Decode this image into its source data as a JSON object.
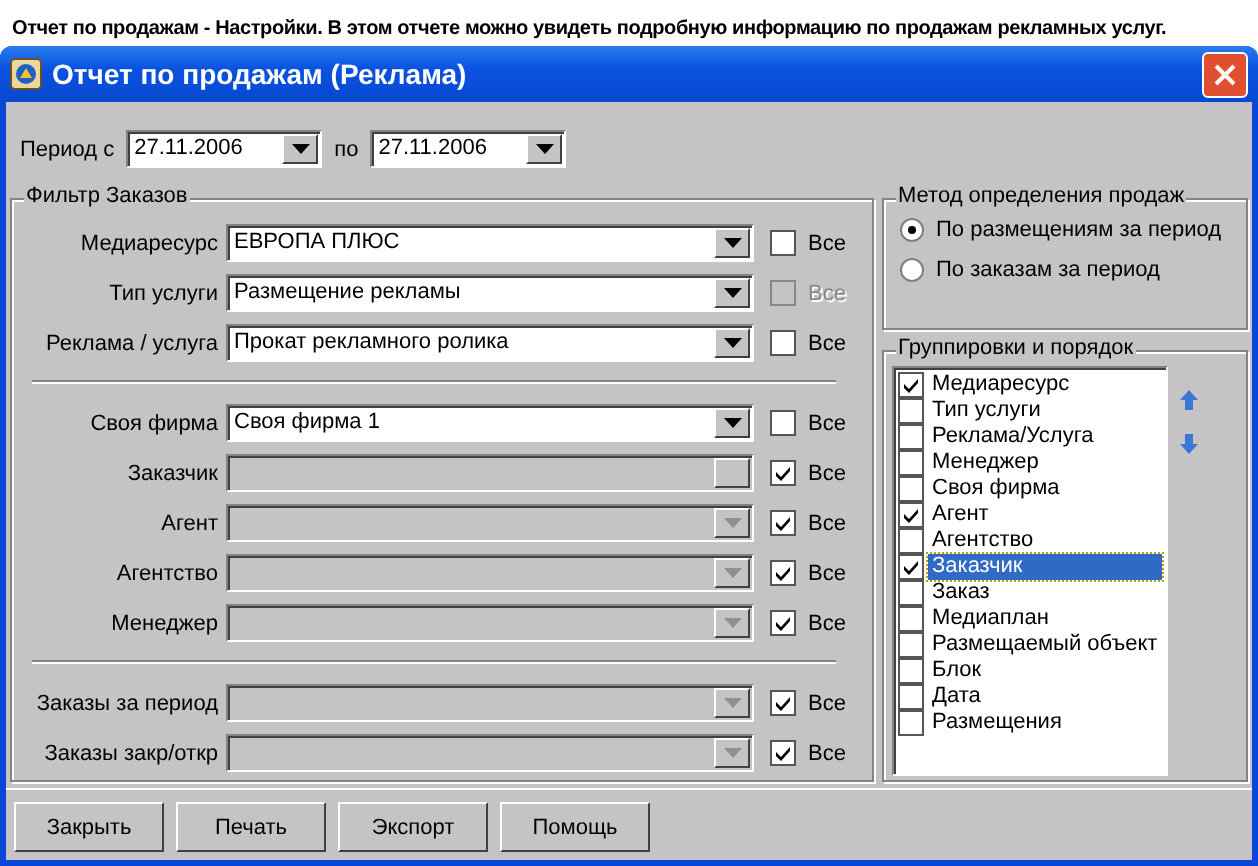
{
  "caption": "Отчет по продажам - Настройки. В этом отчете можно увидеть подробную информацию по продажам рекламных услуг.",
  "window": {
    "title": "Отчет по продажам (Реклама)"
  },
  "period": {
    "from_label": "Период с",
    "from": "27.11.2006",
    "to_label": "по",
    "to": "27.11.2006"
  },
  "filter": {
    "title": "Фильтр Заказов",
    "groups": [
      [
        {
          "label": "Медиаресурс",
          "value": "ЕВРОПА ПЛЮС",
          "disabled": false,
          "all_label": "Все",
          "all_checked": false,
          "all_disabled": false
        },
        {
          "label": "Тип услуги",
          "value": "Размещение рекламы",
          "disabled": false,
          "all_label": "Все",
          "all_checked": false,
          "all_disabled": true
        },
        {
          "label": "Реклама / услуга",
          "value": "Прокат рекламного ролика",
          "disabled": false,
          "all_label": "Все",
          "all_checked": false,
          "all_disabled": false
        }
      ],
      [
        {
          "label": "Своя фирма",
          "value": "Своя фирма 1",
          "disabled": false,
          "all_label": "Все",
          "all_checked": false,
          "all_disabled": false
        },
        {
          "label": "Заказчик",
          "disabled": true,
          "all_label": "Все",
          "all_checked": true,
          "all_disabled": false
        },
        {
          "label": "Агент",
          "disabled": true,
          "all_label": "Все",
          "all_checked": true,
          "all_disabled": false
        },
        {
          "label": "Агентство",
          "disabled": true,
          "all_label": "Все",
          "all_checked": true,
          "all_disabled": false
        },
        {
          "label": "Менеджер",
          "disabled": true,
          "all_label": "Все",
          "all_checked": true,
          "all_disabled": false
        }
      ],
      [
        {
          "label": "Заказы за период",
          "disabled": true,
          "all_label": "Все",
          "all_checked": true,
          "all_disabled": false
        },
        {
          "label": "Заказы закр/откр",
          "disabled": true,
          "all_label": "Все",
          "all_checked": true,
          "all_disabled": false
        }
      ]
    ]
  },
  "method": {
    "title": "Метод определения продаж",
    "options": [
      {
        "label": "По размещениям за период",
        "selected": true
      },
      {
        "label": "По заказам за период",
        "selected": false
      }
    ]
  },
  "grouping": {
    "title": "Группировки и порядок",
    "items": [
      {
        "label": "Медиаресурс",
        "checked": true,
        "selected": false
      },
      {
        "label": "Тип услуги",
        "checked": false,
        "selected": false
      },
      {
        "label": "Реклама/Услуга",
        "checked": false,
        "selected": false
      },
      {
        "label": "Менеджер",
        "checked": false,
        "selected": false
      },
      {
        "label": "Своя фирма",
        "checked": false,
        "selected": false
      },
      {
        "label": "Агент",
        "checked": true,
        "selected": false
      },
      {
        "label": "Агентство",
        "checked": false,
        "selected": false
      },
      {
        "label": "Заказчик",
        "checked": true,
        "selected": true
      },
      {
        "label": "Заказ",
        "checked": false,
        "selected": false
      },
      {
        "label": "Медиаплан",
        "checked": false,
        "selected": false
      },
      {
        "label": "Размещаемый объект",
        "checked": false,
        "selected": false
      },
      {
        "label": "Блок",
        "checked": false,
        "selected": false
      },
      {
        "label": "Дата",
        "checked": false,
        "selected": false
      },
      {
        "label": "Размещения",
        "checked": false,
        "selected": false
      }
    ]
  },
  "buttons": [
    "Закрыть",
    "Печать",
    "Экспорт",
    "Помощь"
  ]
}
